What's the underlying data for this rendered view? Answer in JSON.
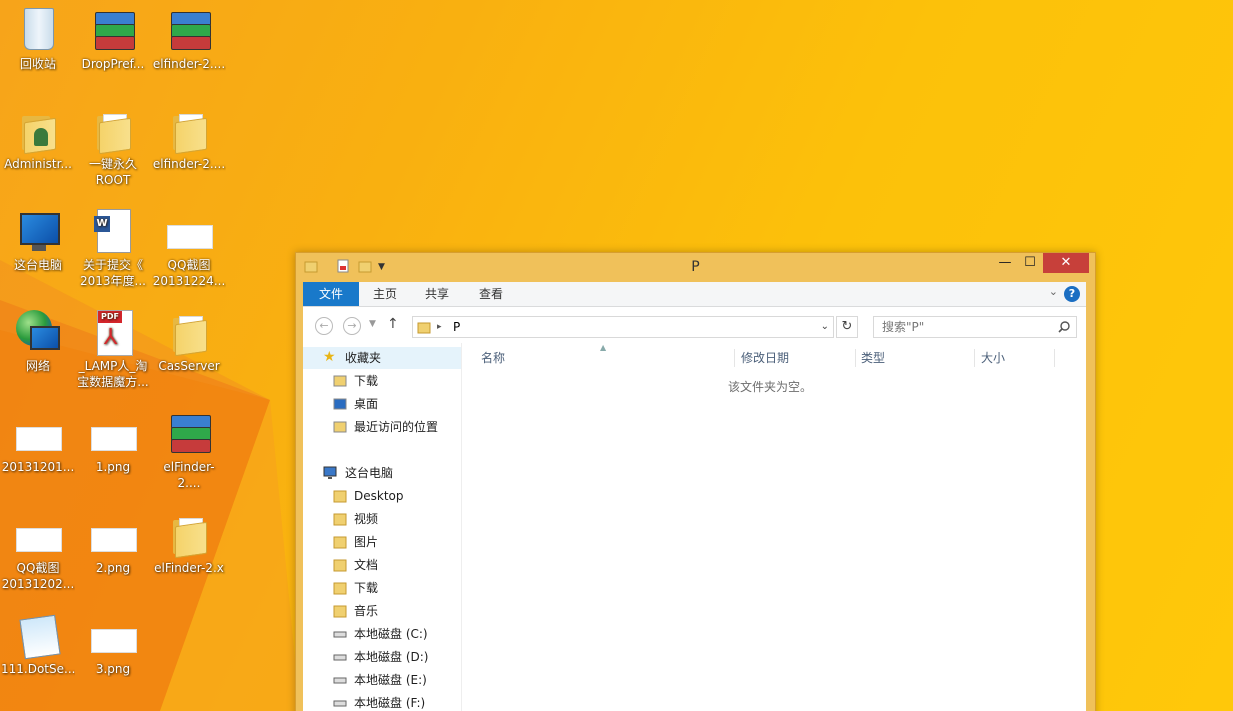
{
  "desktop": {
    "icons": [
      {
        "label": "回收站",
        "kind": "bin"
      },
      {
        "label": "DropPref...",
        "kind": "rar"
      },
      {
        "label": "elfinder-2....",
        "kind": "rar"
      },
      {
        "label": "Administr...",
        "kind": "user-folder"
      },
      {
        "label": "一键永久\nROOT",
        "kind": "folder"
      },
      {
        "label": "elfinder-2....",
        "kind": "folder"
      },
      {
        "label": "这台电脑",
        "kind": "computer"
      },
      {
        "label": "关于提交《\n2013年度...",
        "kind": "word"
      },
      {
        "label": "QQ截图\n20131224...",
        "kind": "image"
      },
      {
        "label": "网络",
        "kind": "network"
      },
      {
        "label": "_LAMP人_淘\n宝数据魔方...",
        "kind": "pdf"
      },
      {
        "label": "CasServer",
        "kind": "folder"
      },
      {
        "label": "20131201...",
        "kind": "image"
      },
      {
        "label": "1.png",
        "kind": "image"
      },
      {
        "label": "elFinder-2....",
        "kind": "rar"
      },
      {
        "label": "QQ截图\n20131202...",
        "kind": "image"
      },
      {
        "label": "2.png",
        "kind": "image"
      },
      {
        "label": "elFinder-2.x",
        "kind": "folder"
      },
      {
        "label": "111.DotSe...",
        "kind": "notepad"
      },
      {
        "label": "3.png",
        "kind": "image"
      }
    ]
  },
  "window": {
    "title": "P",
    "controls": {
      "minimize": "—",
      "maximize": "☐",
      "close": "✕"
    },
    "ribbon": {
      "tabs": [
        "文件",
        "主页",
        "共享",
        "查看"
      ],
      "help": "?"
    },
    "nav": {
      "back": "←",
      "forward": "→",
      "up": "↑",
      "address": "P",
      "address_sep": "▸",
      "search_placeholder": "搜索\"P\"",
      "refresh": "↻"
    },
    "navpane": {
      "favorites_header": "收藏夹",
      "favorites": [
        "下载",
        "桌面",
        "最近访问的位置"
      ],
      "pc_header": "这台电脑",
      "pc_items": [
        "Desktop",
        "视频",
        "图片",
        "文档",
        "下载",
        "音乐",
        "本地磁盘 (C:)",
        "本地磁盘 (D:)",
        "本地磁盘 (E:)",
        "本地磁盘 (F:)"
      ]
    },
    "columns": [
      "名称",
      "修改日期",
      "类型",
      "大小"
    ],
    "empty_message": "该文件夹为空。"
  }
}
